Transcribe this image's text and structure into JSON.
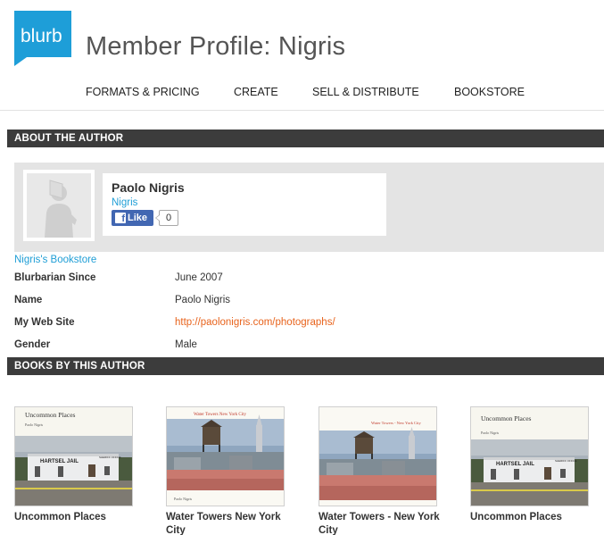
{
  "header": {
    "logo_text": "blurb",
    "page_title": "Member Profile: Nigris",
    "brand_color": "#1e9ed8"
  },
  "nav": {
    "items": [
      {
        "label": "FORMATS & PRICING"
      },
      {
        "label": "CREATE"
      },
      {
        "label": "SELL & DISTRIBUTE"
      },
      {
        "label": "BOOKSTORE"
      }
    ]
  },
  "about": {
    "section_title": "ABOUT THE AUTHOR",
    "author_name": "Paolo Nigris",
    "handle": "Nigris",
    "like_label": "Like",
    "like_count": "0",
    "bookstore_link": "Nigris's Bookstore",
    "details": [
      {
        "label": "Blurbarian Since",
        "value": "June 2007"
      },
      {
        "label": "Name",
        "value": "Paolo Nigris"
      },
      {
        "label": "My Web Site",
        "value": "http://paolonigris.com/photographs/"
      },
      {
        "label": "Gender",
        "value": "Male"
      }
    ]
  },
  "books": {
    "section_title": "BOOKS BY THIS AUTHOR",
    "items": [
      {
        "title": "Uncommon Places",
        "cover_title": "Uncommon Places",
        "cover_subtitle": "Paolo Nigris",
        "cover_sign": "HARTSEL  JAIL",
        "cover_sign2": "SHERIFF OFFICE"
      },
      {
        "title": "Water Towers New York City",
        "cover_title": "Water Towers   New York City",
        "cover_subtitle": "Paolo Nigris"
      },
      {
        "title": "Water Towers - New York City",
        "cover_title": "Water Towers - New York City",
        "cover_subtitle": ""
      },
      {
        "title": "Uncommon Places",
        "cover_title": "Uncommon Places",
        "cover_subtitle": "Paolo Nigris",
        "cover_sign": "HARTSEL  JAIL",
        "cover_sign2": "SHERIFF OFFICE"
      }
    ]
  },
  "colors": {
    "section_bar": "#3c3c3c",
    "link_blue": "#1f9ed6",
    "link_orange": "#e8631c",
    "facebook": "#4267b2"
  }
}
